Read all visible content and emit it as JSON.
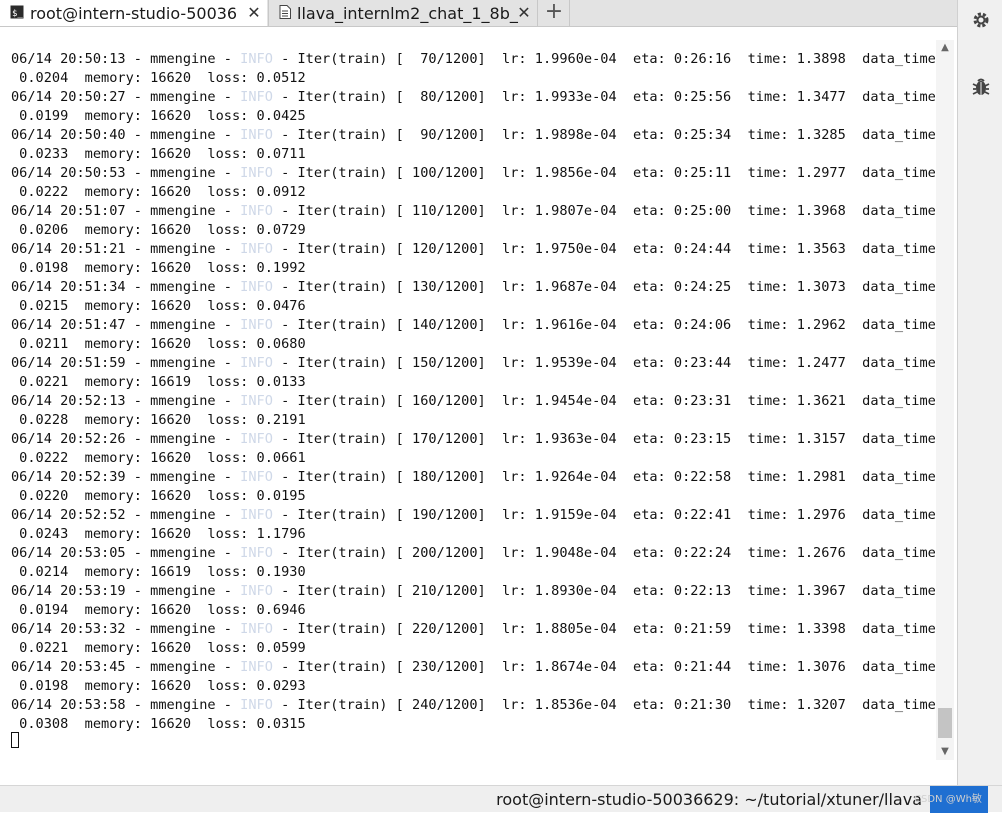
{
  "tabs": [
    {
      "label": "root@intern-studio-50036",
      "icon": "terminal-icon",
      "active": true
    },
    {
      "label": "llava_internlm2_chat_1_8b_",
      "icon": "document-icon",
      "active": false
    }
  ],
  "tab_close_symbol": "✕",
  "tab_add_symbol": "+",
  "side_panel": {
    "icons": [
      "settings-icon",
      "bug-icon"
    ]
  },
  "terminal": {
    "lines": [
      {
        "pre": "06/14 20:50:13 - mmengine - ",
        "level": "INFO",
        "post": " - Iter(train) [  70/1200]  lr: 1.9960e-04  eta: 0:26:16  time: 1.3898  data_time:"
      },
      {
        "pre": " 0.0204  memory: 16620  loss: 0.0512"
      },
      {
        "pre": "06/14 20:50:27 - mmengine - ",
        "level": "INFO",
        "post": " - Iter(train) [  80/1200]  lr: 1.9933e-04  eta: 0:25:56  time: 1.3477  data_time:"
      },
      {
        "pre": " 0.0199  memory: 16620  loss: 0.0425"
      },
      {
        "pre": "06/14 20:50:40 - mmengine - ",
        "level": "INFO",
        "post": " - Iter(train) [  90/1200]  lr: 1.9898e-04  eta: 0:25:34  time: 1.3285  data_time:"
      },
      {
        "pre": " 0.0233  memory: 16620  loss: 0.0711"
      },
      {
        "pre": "06/14 20:50:53 - mmengine - ",
        "level": "INFO",
        "post": " - Iter(train) [ 100/1200]  lr: 1.9856e-04  eta: 0:25:11  time: 1.2977  data_time:"
      },
      {
        "pre": " 0.0222  memory: 16620  loss: 0.0912"
      },
      {
        "pre": "06/14 20:51:07 - mmengine - ",
        "level": "INFO",
        "post": " - Iter(train) [ 110/1200]  lr: 1.9807e-04  eta: 0:25:00  time: 1.3968  data_time:"
      },
      {
        "pre": " 0.0206  memory: 16620  loss: 0.0729"
      },
      {
        "pre": "06/14 20:51:21 - mmengine - ",
        "level": "INFO",
        "post": " - Iter(train) [ 120/1200]  lr: 1.9750e-04  eta: 0:24:44  time: 1.3563  data_time:"
      },
      {
        "pre": " 0.0198  memory: 16620  loss: 0.1992"
      },
      {
        "pre": "06/14 20:51:34 - mmengine - ",
        "level": "INFO",
        "post": " - Iter(train) [ 130/1200]  lr: 1.9687e-04  eta: 0:24:25  time: 1.3073  data_time:"
      },
      {
        "pre": " 0.0215  memory: 16620  loss: 0.0476"
      },
      {
        "pre": "06/14 20:51:47 - mmengine - ",
        "level": "INFO",
        "post": " - Iter(train) [ 140/1200]  lr: 1.9616e-04  eta: 0:24:06  time: 1.2962  data_time:"
      },
      {
        "pre": " 0.0211  memory: 16620  loss: 0.0680"
      },
      {
        "pre": "06/14 20:51:59 - mmengine - ",
        "level": "INFO",
        "post": " - Iter(train) [ 150/1200]  lr: 1.9539e-04  eta: 0:23:44  time: 1.2477  data_time:"
      },
      {
        "pre": " 0.0221  memory: 16619  loss: 0.0133"
      },
      {
        "pre": "06/14 20:52:13 - mmengine - ",
        "level": "INFO",
        "post": " - Iter(train) [ 160/1200]  lr: 1.9454e-04  eta: 0:23:31  time: 1.3621  data_time:"
      },
      {
        "pre": " 0.0228  memory: 16620  loss: 0.2191"
      },
      {
        "pre": "06/14 20:52:26 - mmengine - ",
        "level": "INFO",
        "post": " - Iter(train) [ 170/1200]  lr: 1.9363e-04  eta: 0:23:15  time: 1.3157  data_time:"
      },
      {
        "pre": " 0.0222  memory: 16620  loss: 0.0661"
      },
      {
        "pre": "06/14 20:52:39 - mmengine - ",
        "level": "INFO",
        "post": " - Iter(train) [ 180/1200]  lr: 1.9264e-04  eta: 0:22:58  time: 1.2981  data_time:"
      },
      {
        "pre": " 0.0220  memory: 16620  loss: 0.0195"
      },
      {
        "pre": "06/14 20:52:52 - mmengine - ",
        "level": "INFO",
        "post": " - Iter(train) [ 190/1200]  lr: 1.9159e-04  eta: 0:22:41  time: 1.2976  data_time:"
      },
      {
        "pre": " 0.0243  memory: 16620  loss: 1.1796"
      },
      {
        "pre": "06/14 20:53:05 - mmengine - ",
        "level": "INFO",
        "post": " - Iter(train) [ 200/1200]  lr: 1.9048e-04  eta: 0:22:24  time: 1.2676  data_time:"
      },
      {
        "pre": " 0.0214  memory: 16619  loss: 0.1930"
      },
      {
        "pre": "06/14 20:53:19 - mmengine - ",
        "level": "INFO",
        "post": " - Iter(train) [ 210/1200]  lr: 1.8930e-04  eta: 0:22:13  time: 1.3967  data_time:"
      },
      {
        "pre": " 0.0194  memory: 16620  loss: 0.6946"
      },
      {
        "pre": "06/14 20:53:32 - mmengine - ",
        "level": "INFO",
        "post": " - Iter(train) [ 220/1200]  lr: 1.8805e-04  eta: 0:21:59  time: 1.3398  data_time:"
      },
      {
        "pre": " 0.0221  memory: 16620  loss: 0.0599"
      },
      {
        "pre": "06/14 20:53:45 - mmengine - ",
        "level": "INFO",
        "post": " - Iter(train) [ 230/1200]  lr: 1.8674e-04  eta: 0:21:44  time: 1.3076  data_time:"
      },
      {
        "pre": " 0.0198  memory: 16620  loss: 0.0293"
      },
      {
        "pre": "06/14 20:53:58 - mmengine - ",
        "level": "INFO",
        "post": " - Iter(train) [ 240/1200]  lr: 1.8536e-04  eta: 0:21:30  time: 1.3207  data_time:"
      },
      {
        "pre": " 0.0308  memory: 16620  loss: 0.0315"
      }
    ]
  },
  "status_bar": {
    "path": "root@intern-studio-50036629: ~/tutorial/xtuner/llava"
  },
  "watermark": "CSDN @Wh敏",
  "colors": {
    "info_level": "#cfd8e8",
    "status_button": "#1f6fd1",
    "tab_bar": "#e3e3e3"
  }
}
